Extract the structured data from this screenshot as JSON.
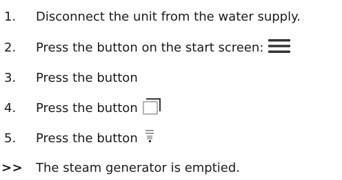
{
  "steps": [
    {
      "number": "1.",
      "text": "Disconnect the unit from the water supply.",
      "icon": null
    },
    {
      "number": "2.",
      "text": "Press the button on the start screen:",
      "icon": "hamburger-menu-icon"
    },
    {
      "number": "3.",
      "text": "Press the button",
      "icon": null
    },
    {
      "number": "4.",
      "text": "Press the button",
      "icon": "window-copy-icon"
    },
    {
      "number": "5.",
      "text": "Press the button",
      "icon": "steam-generator-drain-icon"
    }
  ],
  "result": {
    "marker": ">>",
    "text": "The steam generator is emptied."
  },
  "colors": {
    "text": "#1a1a1a",
    "icon_dark": "#333333",
    "icon_light": "#9a9a9a"
  }
}
